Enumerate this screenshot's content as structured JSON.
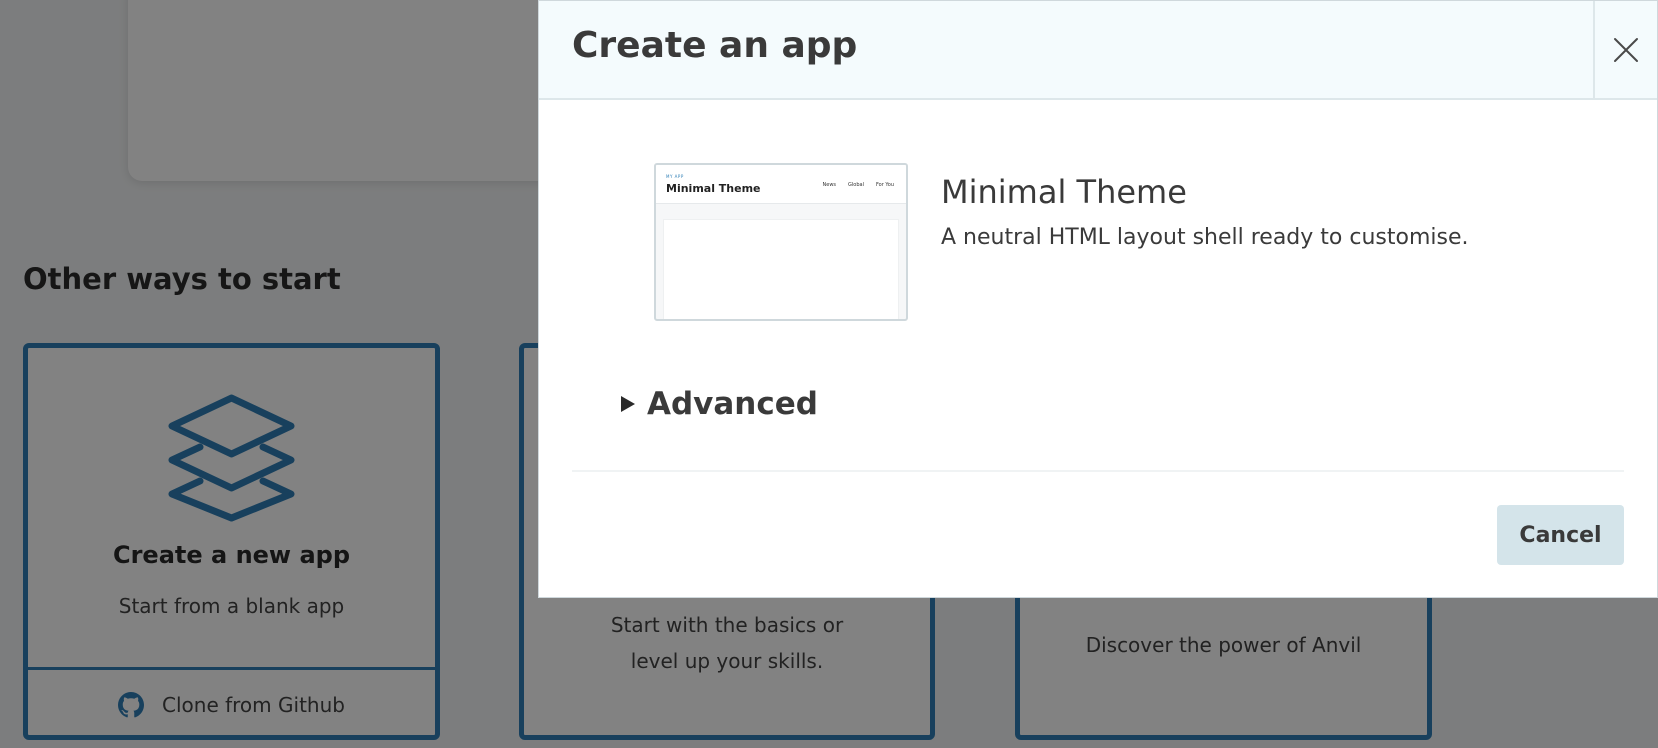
{
  "background": {
    "section_heading": "Other ways to start",
    "cards": [
      {
        "icon": "layers-icon",
        "title": "Create a new app",
        "subtitle": "Start from a blank app",
        "secondary_action": "Clone from Github",
        "secondary_icon": "github-icon"
      },
      {
        "subtitle": "Start with the basics or level up your skills."
      },
      {
        "subtitle": "Discover the power of Anvil"
      }
    ]
  },
  "modal": {
    "title": "Create an app",
    "close_icon": "close-icon",
    "theme": {
      "thumb_title": "Minimal Theme",
      "thumb_small": "MY APP",
      "thumb_nav": [
        "News",
        "Global",
        "For You"
      ],
      "name": "Minimal Theme",
      "description": "A neutral HTML layout shell ready to customise."
    },
    "advanced_label": "Advanced",
    "cancel_label": "Cancel"
  },
  "colors": {
    "accent": "#2f7fb6",
    "overlay": "rgba(0,0,0,0.49)",
    "cancel_bg": "#d4e4ea",
    "modal_header_bg": "#f4fbfd"
  }
}
